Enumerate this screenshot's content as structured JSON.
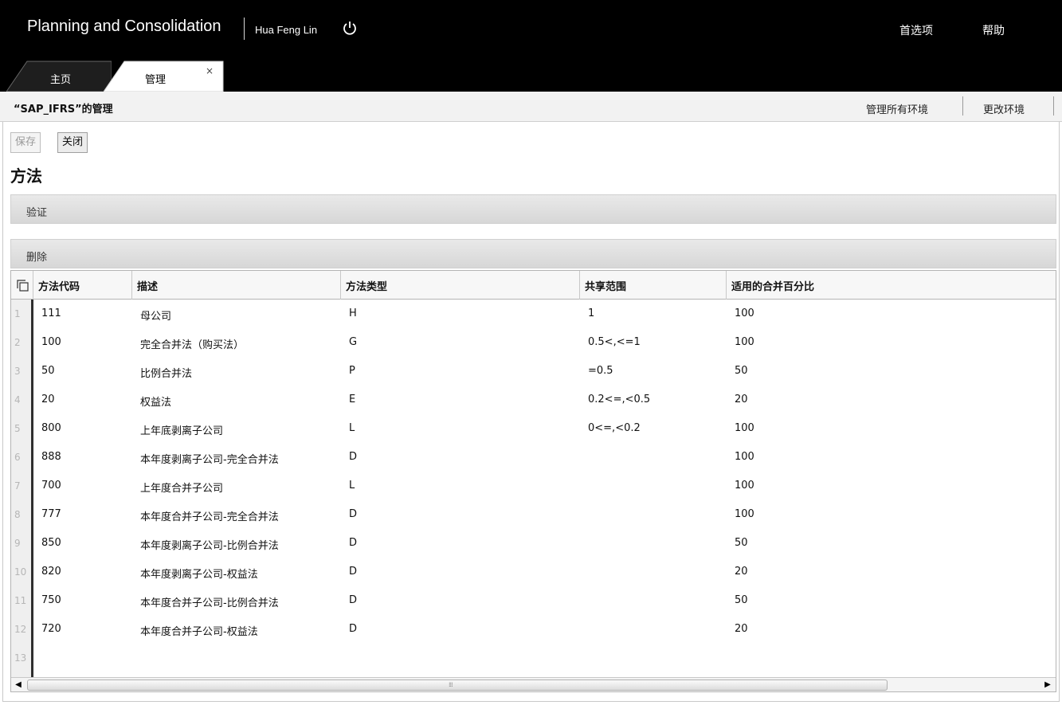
{
  "header": {
    "app_title": "Planning and Consolidation",
    "user_name": "Hua Feng Lin",
    "preferences": "首选项",
    "help": "帮助"
  },
  "tabs": [
    {
      "label": "主页"
    },
    {
      "label": "管理",
      "close": "×"
    }
  ],
  "subheader": {
    "context_title": "“SAP_IFRS”的管理",
    "manage_all": "管理所有环境",
    "change_env": "更改环境"
  },
  "toolbar": {
    "save_label": "保存",
    "close_label": "关闭"
  },
  "section": {
    "title": "方法",
    "validate_label": "验证",
    "delete_label": "删除"
  },
  "grid": {
    "columns": [
      "方法代码",
      "描述",
      "方法类型",
      "共享范围",
      "适用的合并百分比"
    ],
    "rows": [
      {
        "num": "1",
        "code": "111",
        "desc": "母公司",
        "type": "H",
        "range": "1",
        "pct": "100"
      },
      {
        "num": "2",
        "code": "100",
        "desc": "完全合并法（购买法）",
        "type": "G",
        "range": "0.5<,<=1",
        "pct": "100"
      },
      {
        "num": "3",
        "code": "50",
        "desc": "比例合并法",
        "type": "P",
        "range": "=0.5",
        "pct": "50"
      },
      {
        "num": "4",
        "code": "20",
        "desc": "权益法",
        "type": "E",
        "range": "0.2<=,<0.5",
        "pct": "20"
      },
      {
        "num": "5",
        "code": "800",
        "desc": "上年底剥离子公司",
        "type": "L",
        "range": "0<=,<0.2",
        "pct": "100"
      },
      {
        "num": "6",
        "code": "888",
        "desc": "本年度剥离子公司-完全合并法",
        "type": "D",
        "range": "",
        "pct": "100"
      },
      {
        "num": "7",
        "code": "700",
        "desc": "上年度合并子公司",
        "type": "L",
        "range": "",
        "pct": "100"
      },
      {
        "num": "8",
        "code": "777",
        "desc": "本年度合并子公司-完全合并法",
        "type": "D",
        "range": "",
        "pct": "100"
      },
      {
        "num": "9",
        "code": "850",
        "desc": "本年度剥离子公司-比例合并法",
        "type": "D",
        "range": "",
        "pct": "50"
      },
      {
        "num": "10",
        "code": "820",
        "desc": "本年度剥离子公司-权益法",
        "type": "D",
        "range": "",
        "pct": "20"
      },
      {
        "num": "11",
        "code": "750",
        "desc": "本年度合并子公司-比例合并法",
        "type": "D",
        "range": "",
        "pct": "50"
      },
      {
        "num": "12",
        "code": "720",
        "desc": "本年度合并子公司-权益法",
        "type": "D",
        "range": "",
        "pct": "20"
      },
      {
        "num": "13",
        "code": "",
        "desc": "",
        "type": "",
        "range": "",
        "pct": ""
      }
    ]
  }
}
